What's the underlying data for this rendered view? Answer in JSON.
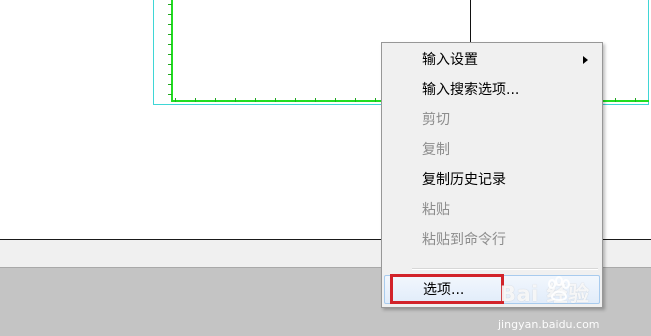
{
  "context_menu": {
    "items": [
      {
        "label": "输入设置",
        "disabled": false,
        "submenu": true
      },
      {
        "label": "输入搜索选项...",
        "disabled": false
      },
      {
        "label": "剪切",
        "disabled": true
      },
      {
        "label": "复制",
        "disabled": true
      },
      {
        "label": "复制历史记录",
        "disabled": false
      },
      {
        "label": "粘贴",
        "disabled": true
      },
      {
        "label": "粘贴到命令行",
        "disabled": true
      },
      {
        "label": "选项...",
        "disabled": false,
        "highlighted": true
      }
    ]
  },
  "watermark": {
    "logo": "Bai  经验",
    "url": "jingyan.baidu.com"
  },
  "colors": {
    "grid_green": "#22dd22",
    "frame_cyan": "#3fd6d6",
    "highlight_red": "#d2232a"
  }
}
